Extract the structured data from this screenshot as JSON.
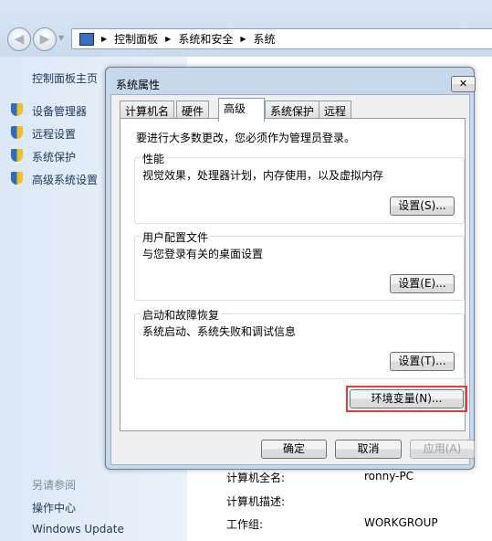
{
  "breadcrumb": [
    "控制面板",
    "系统和安全",
    "系统"
  ],
  "sidebar": {
    "home": "控制面板主页",
    "items": [
      "设备管理器",
      "远程设置",
      "系统保护",
      "高级系统设置"
    ],
    "see_also": "另请参阅",
    "links": [
      "操作中心",
      "Windows Update"
    ]
  },
  "info": [
    {
      "label": "计算机全名:",
      "value": "ronny-PC"
    },
    {
      "label": "计算机描述:",
      "value": ""
    },
    {
      "label": "工作组:",
      "value": "WORKGROUP"
    }
  ],
  "dialog": {
    "title": "系统属性",
    "close": "✕",
    "tabs": [
      "计算机名",
      "硬件",
      "高级",
      "系统保护",
      "远程"
    ],
    "admin_note": "要进行大多数更改，您必须作为管理员登录。",
    "groups": [
      {
        "title": "性能",
        "desc": "视觉效果，处理器计划，内存使用，以及虚拟内存",
        "button": "设置(S)..."
      },
      {
        "title": "用户配置文件",
        "desc": "与您登录有关的桌面设置",
        "button": "设置(E)..."
      },
      {
        "title": "启动和故障恢复",
        "desc": "系统启动、系统失败和调试信息",
        "button": "设置(T)..."
      }
    ],
    "env_button": "环境变量(N)...",
    "ok": "确定",
    "cancel": "取消",
    "apply": "应用(A)"
  },
  "colors": {
    "highlight": "#e8383d"
  }
}
